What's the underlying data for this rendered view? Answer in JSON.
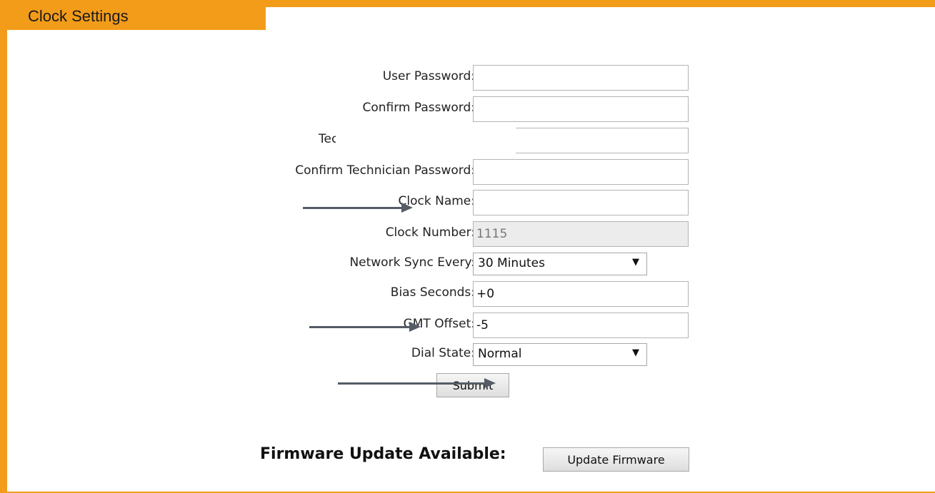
{
  "panel": {
    "title": "Clock Settings"
  },
  "form": {
    "user_password": {
      "label": "User Password:",
      "value": ""
    },
    "confirm_password": {
      "label": "Confirm Password:",
      "value": ""
    },
    "technician_password": {
      "label": "Tec",
      "value": ""
    },
    "confirm_technician_password": {
      "label": "Confirm Technician Password:",
      "value": ""
    },
    "clock_name": {
      "label": "Clock Name:",
      "value": ""
    },
    "clock_number": {
      "label": "Clock Number:",
      "value": "1115"
    },
    "network_sync": {
      "label": "Network Sync Every:",
      "selected": "30 Minutes"
    },
    "bias_seconds": {
      "label": "Bias Seconds:",
      "value": "+0"
    },
    "gmt_offset": {
      "label": "GMT Offset:",
      "value": "-5"
    },
    "dial_state": {
      "label": "Dial State:",
      "selected": "Normal"
    },
    "submit_label": "Submit"
  },
  "firmware": {
    "label": "Firmware Update Available:",
    "button_label": "Update Firmware"
  },
  "icons": {
    "dropdown": "chevron-down-icon",
    "annotation": "arrow-right-icon"
  },
  "colors": {
    "accent": "#f39c1a",
    "annotation_arrow": "#555c66"
  }
}
